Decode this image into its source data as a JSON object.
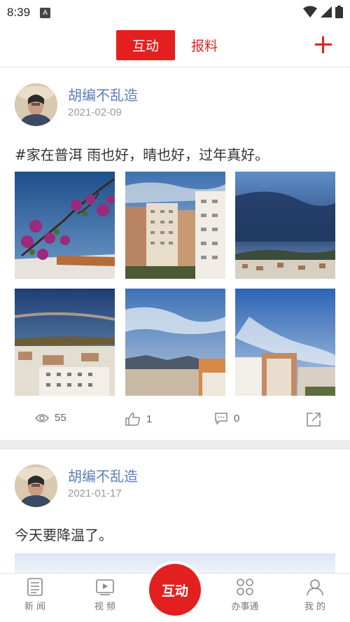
{
  "status_bar": {
    "time": "8:39",
    "app_indicator": "A"
  },
  "header": {
    "tabs": [
      {
        "label": "互动",
        "active": true
      },
      {
        "label": "报料",
        "active": false
      }
    ],
    "add_icon": "plus-icon",
    "accent_color": "#e41f1f"
  },
  "posts": [
    {
      "author": "胡编不乱造",
      "date": "2021-02-09",
      "text": "#家在普洱  雨也好，晴也好，过年真好。",
      "photos": [
        "bougainvillea-sky",
        "apartment-buildings",
        "cloudy-sky-city",
        "sunset-clouds-city",
        "clouds-mountains-buildings",
        "blue-sky-building"
      ],
      "views": "55",
      "likes": "1",
      "comments": "0"
    },
    {
      "author": "胡编不乱造",
      "date": "2021-01-17",
      "text": "今天要降温了。"
    }
  ],
  "bottom_nav": {
    "items": [
      {
        "label": "新 闻",
        "icon": "news-icon"
      },
      {
        "label": "视 频",
        "icon": "video-icon"
      },
      {
        "label": "互动",
        "icon": "interact-button"
      },
      {
        "label": "办事通",
        "icon": "services-icon"
      },
      {
        "label": "我 的",
        "icon": "profile-icon"
      }
    ]
  }
}
